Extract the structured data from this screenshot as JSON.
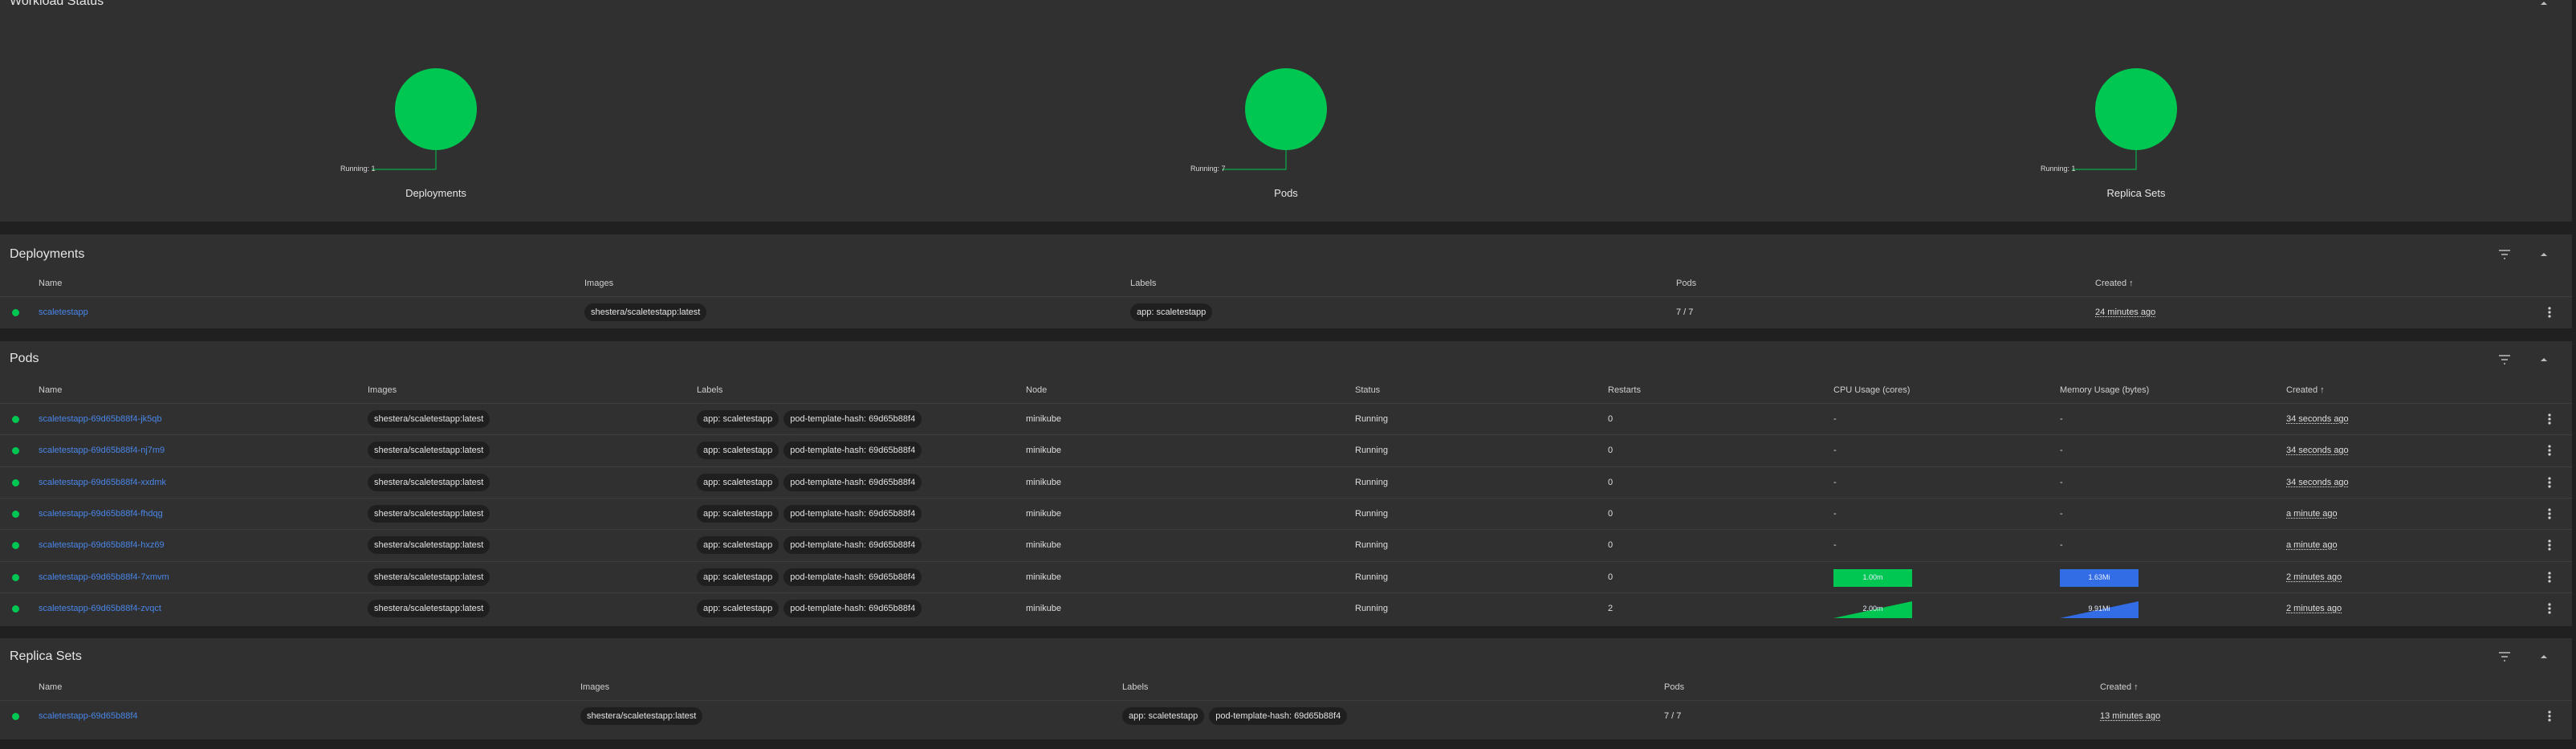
{
  "workload_status": {
    "title": "Workload Status",
    "items": [
      {
        "name": "Deployments",
        "running_label": "Running: 1",
        "color": "#00c752"
      },
      {
        "name": "Pods",
        "running_label": "Running: 7",
        "color": "#00c752"
      },
      {
        "name": "Replica Sets",
        "running_label": "Running: 1",
        "color": "#00c752"
      }
    ]
  },
  "deployments": {
    "title": "Deployments",
    "columns": [
      "Name",
      "Images",
      "Labels",
      "Pods",
      "Created"
    ],
    "rows": [
      {
        "name": "scaletestapp",
        "image": "shestera/scaletestapp:latest",
        "labels": [
          "app: scaletestapp"
        ],
        "pods": "7 / 7",
        "created": "24 minutes ago"
      }
    ]
  },
  "pods": {
    "title": "Pods",
    "columns": [
      "Name",
      "Images",
      "Labels",
      "Node",
      "Status",
      "Restarts",
      "CPU Usage (cores)",
      "Memory Usage (bytes)",
      "Created"
    ],
    "rows": [
      {
        "name": "scaletestapp-69d65b88f4-jk5qb",
        "image": "shestera/scaletestapp:latest",
        "labels": [
          "app: scaletestapp",
          "pod-template-hash: 69d65b88f4"
        ],
        "node": "minikube",
        "status": "Running",
        "restarts": "0",
        "cpu": "-",
        "memory": "-",
        "created": "34 seconds ago"
      },
      {
        "name": "scaletestapp-69d65b88f4-nj7m9",
        "image": "shestera/scaletestapp:latest",
        "labels": [
          "app: scaletestapp",
          "pod-template-hash: 69d65b88f4"
        ],
        "node": "minikube",
        "status": "Running",
        "restarts": "0",
        "cpu": "-",
        "memory": "-",
        "created": "34 seconds ago"
      },
      {
        "name": "scaletestapp-69d65b88f4-xxdmk",
        "image": "shestera/scaletestapp:latest",
        "labels": [
          "app: scaletestapp",
          "pod-template-hash: 69d65b88f4"
        ],
        "node": "minikube",
        "status": "Running",
        "restarts": "0",
        "cpu": "-",
        "memory": "-",
        "created": "34 seconds ago"
      },
      {
        "name": "scaletestapp-69d65b88f4-fhdqg",
        "image": "shestera/scaletestapp:latest",
        "labels": [
          "app: scaletestapp",
          "pod-template-hash: 69d65b88f4"
        ],
        "node": "minikube",
        "status": "Running",
        "restarts": "0",
        "cpu": "-",
        "memory": "-",
        "created": "a minute ago"
      },
      {
        "name": "scaletestapp-69d65b88f4-hxz69",
        "image": "shestera/scaletestapp:latest",
        "labels": [
          "app: scaletestapp",
          "pod-template-hash: 69d65b88f4"
        ],
        "node": "minikube",
        "status": "Running",
        "restarts": "0",
        "cpu": "-",
        "memory": "-",
        "created": "a minute ago"
      },
      {
        "name": "scaletestapp-69d65b88f4-7xmvm",
        "image": "shestera/scaletestapp:latest",
        "labels": [
          "app: scaletestapp",
          "pod-template-hash: 69d65b88f4"
        ],
        "node": "minikube",
        "status": "Running",
        "restarts": "0",
        "cpu": "1.00m",
        "memory": "1.63Mi",
        "created": "2 minutes ago"
      },
      {
        "name": "scaletestapp-69d65b88f4-zvqct",
        "image": "shestera/scaletestapp:latest",
        "labels": [
          "app: scaletestapp",
          "pod-template-hash: 69d65b88f4"
        ],
        "node": "minikube",
        "status": "Running",
        "restarts": "2",
        "cpu": "2.00m",
        "memory": "9.91Mi",
        "created": "2 minutes ago"
      }
    ]
  },
  "replica_sets": {
    "title": "Replica Sets",
    "columns": [
      "Name",
      "Images",
      "Labels",
      "Pods",
      "Created"
    ],
    "rows": [
      {
        "name": "scaletestapp-69d65b88f4",
        "image": "shestera/scaletestapp:latest",
        "labels": [
          "app: scaletestapp",
          "pod-template-hash: 69d65b88f4"
        ],
        "pods": "7 / 7",
        "created": "13 minutes ago"
      }
    ]
  },
  "colors": {
    "running": "#00c752",
    "link": "#4a86e8",
    "cpu_spark": "#00c752",
    "memory_spark": "#326de6"
  }
}
